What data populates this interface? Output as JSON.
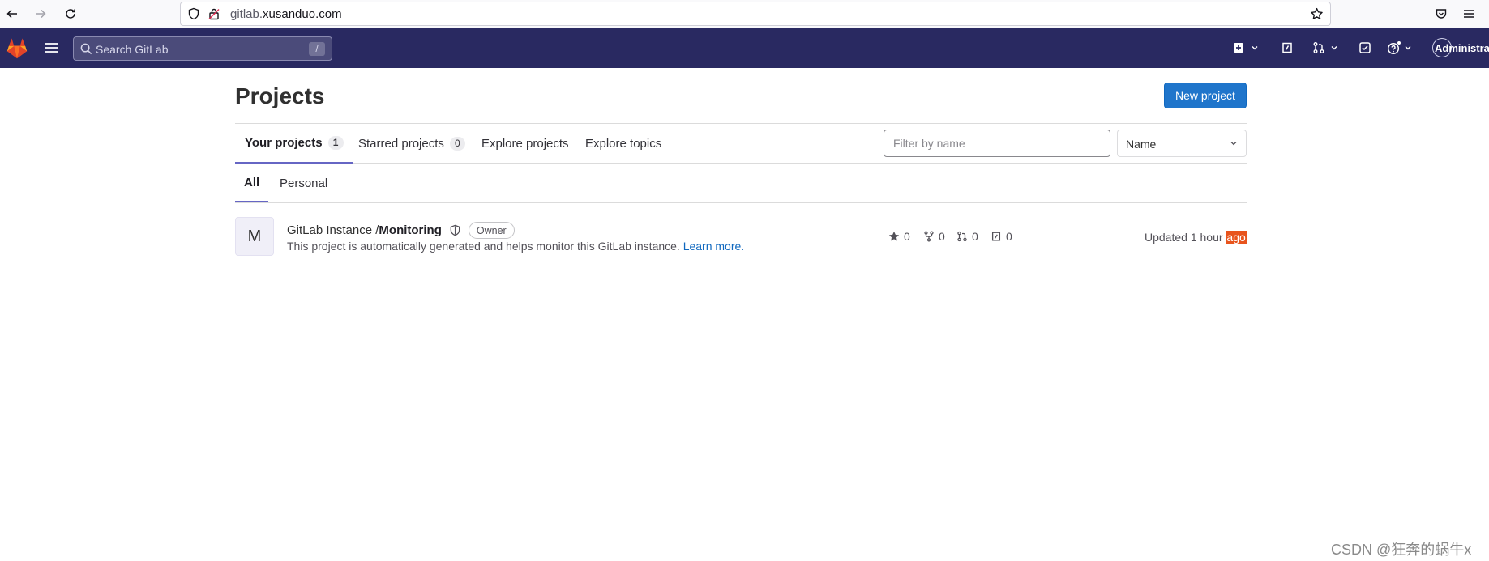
{
  "browser": {
    "url_host_prefix": "gitlab.",
    "url_host_main": "xusanduo.com"
  },
  "header": {
    "search_placeholder": "Search GitLab",
    "search_shortcut": "/",
    "user_label": "Administrat"
  },
  "page": {
    "title": "Projects",
    "new_project_label": "New project"
  },
  "tabs": [
    {
      "label": "Your projects",
      "count": "1"
    },
    {
      "label": "Starred projects",
      "count": "0"
    },
    {
      "label": "Explore projects"
    },
    {
      "label": "Explore topics"
    }
  ],
  "filter": {
    "placeholder": "Filter by name",
    "sort_label": "Name"
  },
  "subtabs": [
    "All",
    "Personal"
  ],
  "project": {
    "avatar_letter": "M",
    "namespace": "GitLab Instance / ",
    "name": "Monitoring",
    "role": "Owner",
    "description": "This project is automatically generated and helps monitor this GitLab instance. ",
    "learn_more": "Learn more.",
    "stars": "0",
    "forks": "0",
    "merge_requests": "0",
    "issues": "0",
    "updated_prefix": "Updated 1 hour ",
    "updated_suffix": "ago"
  },
  "watermark": "CSDN @狂奔的蜗牛x",
  "colors": {
    "header_bg": "#292961",
    "primary_button": "#1f75cb",
    "tab_underline": "#6666c4",
    "link": "#1068bf",
    "highlight": "#e8541d"
  }
}
